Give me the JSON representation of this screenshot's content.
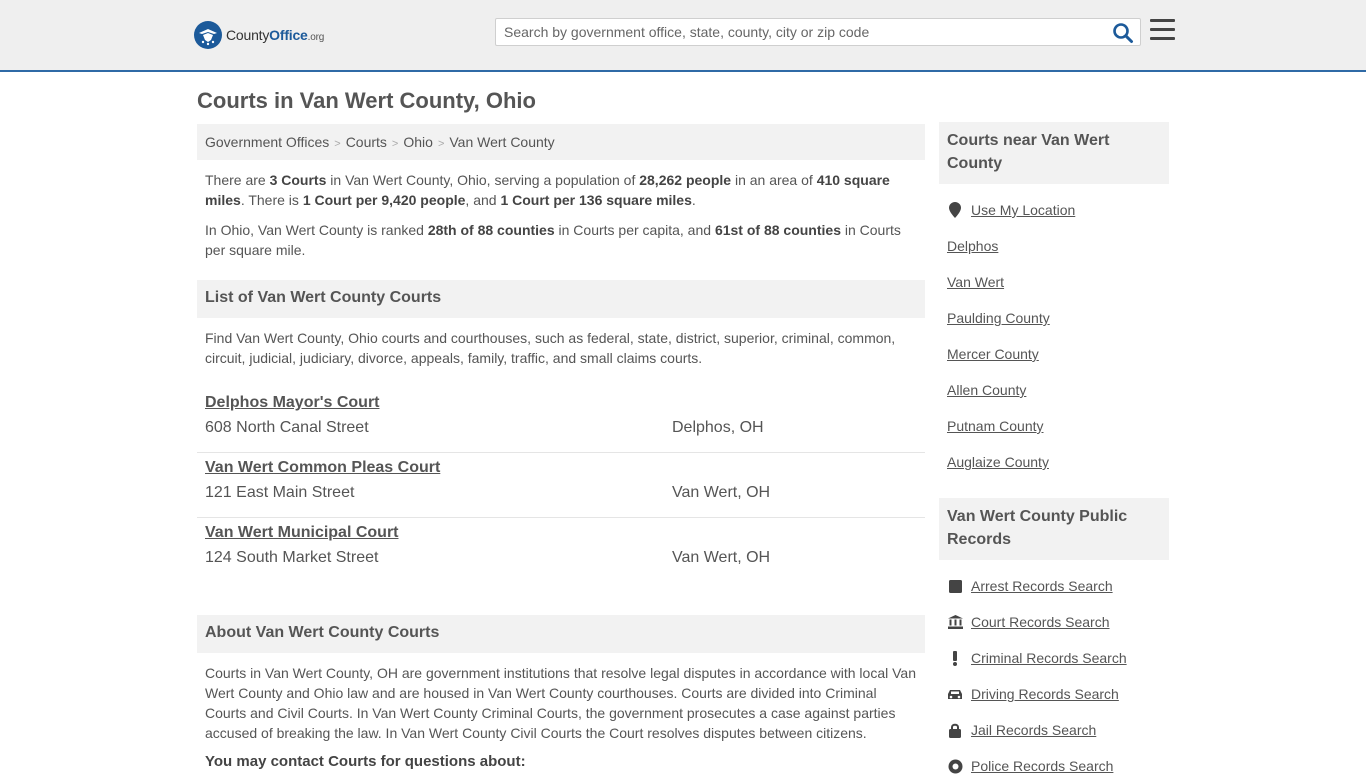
{
  "header": {
    "logo_prefix": "County",
    "logo_bold": "Office",
    "logo_suffix": ".org",
    "search_placeholder": "Search by government office, state, county, city or zip code"
  },
  "page_title": "Courts in Van Wert County, Ohio",
  "breadcrumb": [
    "Government Offices",
    "Courts",
    "Ohio",
    "Van Wert County"
  ],
  "intro": {
    "t1": "There are ",
    "b1": "3 Courts",
    "t2": " in Van Wert County, Ohio, serving a population of ",
    "b2": "28,262 people",
    "t3": " in an area of ",
    "b3": "410 square miles",
    "t4": ". There is ",
    "b4": "1 Court per 9,420 people",
    "t5": ", and ",
    "b5": "1 Court per 136 square miles",
    "t6": "."
  },
  "rank": {
    "t1": "In Ohio, Van Wert County is ranked ",
    "b1": "28th of 88 counties",
    "t2": " in Courts per capita, and ",
    "b2": "61st of 88 counties",
    "t3": " in Courts per square mile."
  },
  "list_section": {
    "title": "List of Van Wert County Courts",
    "description": "Find Van Wert County, Ohio courts and courthouses, such as federal, state, district, superior, criminal, common, circuit, judicial, judiciary, divorce, appeals, family, traffic, and small claims courts."
  },
  "courts": [
    {
      "name": "Delphos Mayor's Court",
      "address": "608 North Canal Street",
      "city": "Delphos, OH"
    },
    {
      "name": "Van Wert Common Pleas Court",
      "address": "121 East Main Street",
      "city": "Van Wert, OH"
    },
    {
      "name": "Van Wert Municipal Court",
      "address": "124 South Market Street",
      "city": "Van Wert, OH"
    }
  ],
  "about_section": {
    "title": "About Van Wert County Courts",
    "text": "Courts in Van Wert County, OH are government institutions that resolve legal disputes in accordance with local Van Wert County and Ohio law and are housed in Van Wert County courthouses. Courts are divided into Criminal Courts and Civil Courts. In Van Wert County Criminal Courts, the government prosecutes a case against parties accused of breaking the law. In Van Wert County Civil Courts the Court resolves disputes between citizens.",
    "contact_heading": "You may contact Courts for questions about:"
  },
  "sidebar": {
    "nearby_title": "Courts near Van Wert County",
    "nearby_links": [
      {
        "label": "Use My Location",
        "icon": "map-marker-icon"
      },
      {
        "label": "Delphos"
      },
      {
        "label": "Van Wert"
      },
      {
        "label": "Paulding County"
      },
      {
        "label": "Mercer County"
      },
      {
        "label": "Allen County"
      },
      {
        "label": "Putnam County"
      },
      {
        "label": "Auglaize County"
      }
    ],
    "records_title": "Van Wert County Public Records",
    "records_links": [
      {
        "label": "Arrest Records Search",
        "icon": "square-icon"
      },
      {
        "label": "Court Records Search",
        "icon": "courthouse-icon"
      },
      {
        "label": "Criminal Records Search",
        "icon": "exclamation-icon"
      },
      {
        "label": "Driving Records Search",
        "icon": "car-icon"
      },
      {
        "label": "Jail Records Search",
        "icon": "lock-icon"
      },
      {
        "label": "Police Records Search",
        "icon": "badge-icon"
      }
    ]
  },
  "colors": {
    "brand_blue": "#1c5a9a",
    "header_bg": "#efefef",
    "panel_bg": "#f2f2f2",
    "text": "#555555"
  }
}
